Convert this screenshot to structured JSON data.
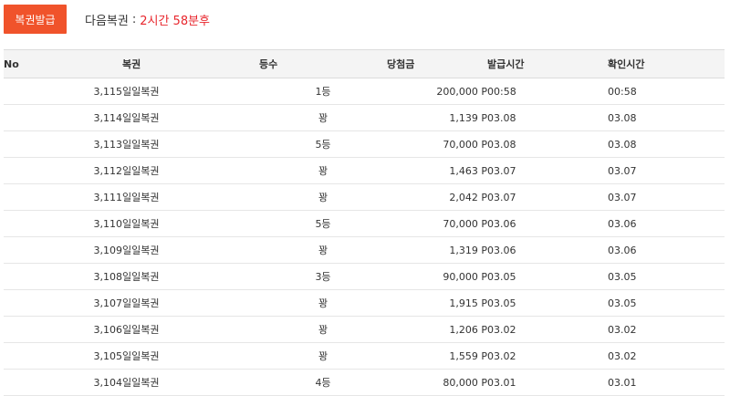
{
  "header": {
    "issue_button_label": "복권발급",
    "next_label": "다음복권",
    "separator": ":",
    "next_time": "2시간 58분후"
  },
  "table": {
    "columns": {
      "no": "No",
      "name": "복권",
      "grade": "등수",
      "prize": "당첨금",
      "issued": "발급시간",
      "checked": "확인시간"
    },
    "rows": [
      {
        "no": "3,115",
        "name": "일일복권",
        "grade": "1등",
        "prize": "200,000 P",
        "issued": "00:58",
        "checked": "00:58"
      },
      {
        "no": "3,114",
        "name": "일일복권",
        "grade": "꽝",
        "prize": "1,139 P",
        "issued": "03.08",
        "checked": "03.08"
      },
      {
        "no": "3,113",
        "name": "일일복권",
        "grade": "5등",
        "prize": "70,000 P",
        "issued": "03.08",
        "checked": "03.08"
      },
      {
        "no": "3,112",
        "name": "일일복권",
        "grade": "꽝",
        "prize": "1,463 P",
        "issued": "03.07",
        "checked": "03.07"
      },
      {
        "no": "3,111",
        "name": "일일복권",
        "grade": "꽝",
        "prize": "2,042 P",
        "issued": "03.07",
        "checked": "03.07"
      },
      {
        "no": "3,110",
        "name": "일일복권",
        "grade": "5등",
        "prize": "70,000 P",
        "issued": "03.06",
        "checked": "03.06"
      },
      {
        "no": "3,109",
        "name": "일일복권",
        "grade": "꽝",
        "prize": "1,319 P",
        "issued": "03.06",
        "checked": "03.06"
      },
      {
        "no": "3,108",
        "name": "일일복권",
        "grade": "3등",
        "prize": "90,000 P",
        "issued": "03.05",
        "checked": "03.05"
      },
      {
        "no": "3,107",
        "name": "일일복권",
        "grade": "꽝",
        "prize": "1,915 P",
        "issued": "03.05",
        "checked": "03.05"
      },
      {
        "no": "3,106",
        "name": "일일복권",
        "grade": "꽝",
        "prize": "1,206 P",
        "issued": "03.02",
        "checked": "03.02"
      },
      {
        "no": "3,105",
        "name": "일일복권",
        "grade": "꽝",
        "prize": "1,559 P",
        "issued": "03.02",
        "checked": "03.02"
      },
      {
        "no": "3,104",
        "name": "일일복권",
        "grade": "4등",
        "prize": "80,000 P",
        "issued": "03.01",
        "checked": "03.01"
      }
    ]
  },
  "colors": {
    "accent": "#f0532b",
    "countdown": "#e8262d",
    "header_bg": "#f4f4f4"
  }
}
